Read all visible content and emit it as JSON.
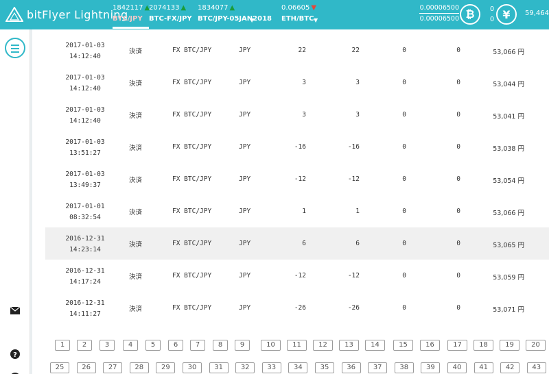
{
  "header": {
    "logo_text": "bitFlyer Lightning",
    "tabs": [
      {
        "price": "1842117",
        "trend": "up",
        "label": "BTC/JPY",
        "active": true
      },
      {
        "price": "2074133",
        "trend": "up",
        "label": "BTC-FX/JPY",
        "active": false
      },
      {
        "price": "1834077",
        "trend": "up",
        "label": "BTC/JPY-05JAN2018",
        "active": false
      },
      {
        "price": "0.06605",
        "trend": "down",
        "label": "ETH/BTC",
        "active": false
      }
    ],
    "btc_balance": {
      "value1": "0.00006500",
      "value2": "0.00006500",
      "icon": "bitcoin-icon"
    },
    "jpy_balance": {
      "value1": "0",
      "value2": "0",
      "icon": "yen-icon",
      "total": "59,464"
    }
  },
  "sidebar": {
    "icons": [
      "menu-icon",
      "mail-icon",
      "help-icon"
    ]
  },
  "table": {
    "rows": [
      {
        "date": "2017-01-03",
        "time": "14:12:40",
        "type": "決済",
        "product": "FX BTC/JPY",
        "currency": "JPY",
        "a": "22",
        "b": "22",
        "c": "0",
        "d": "0",
        "e": "53,066 円"
      },
      {
        "date": "2017-01-03",
        "time": "14:12:40",
        "type": "決済",
        "product": "FX BTC/JPY",
        "currency": "JPY",
        "a": "3",
        "b": "3",
        "c": "0",
        "d": "0",
        "e": "53,044 円"
      },
      {
        "date": "2017-01-03",
        "time": "14:12:40",
        "type": "決済",
        "product": "FX BTC/JPY",
        "currency": "JPY",
        "a": "3",
        "b": "3",
        "c": "0",
        "d": "0",
        "e": "53,041 円"
      },
      {
        "date": "2017-01-03",
        "time": "13:51:27",
        "type": "決済",
        "product": "FX BTC/JPY",
        "currency": "JPY",
        "a": "-16",
        "b": "-16",
        "c": "0",
        "d": "0",
        "e": "53,038 円"
      },
      {
        "date": "2017-01-03",
        "time": "13:49:37",
        "type": "決済",
        "product": "FX BTC/JPY",
        "currency": "JPY",
        "a": "-12",
        "b": "-12",
        "c": "0",
        "d": "0",
        "e": "53,054 円"
      },
      {
        "date": "2017-01-01",
        "time": "08:32:54",
        "type": "決済",
        "product": "FX BTC/JPY",
        "currency": "JPY",
        "a": "1",
        "b": "1",
        "c": "0",
        "d": "0",
        "e": "53,066 円"
      },
      {
        "date": "2016-12-31",
        "time": "14:23:14",
        "type": "決済",
        "product": "FX BTC/JPY",
        "currency": "JPY",
        "a": "6",
        "b": "6",
        "c": "0",
        "d": "0",
        "e": "53,065 円",
        "highlight": true
      },
      {
        "date": "2016-12-31",
        "time": "14:17:24",
        "type": "決済",
        "product": "FX BTC/JPY",
        "currency": "JPY",
        "a": "-12",
        "b": "-12",
        "c": "0",
        "d": "0",
        "e": "53,059 円"
      },
      {
        "date": "2016-12-31",
        "time": "14:11:27",
        "type": "決済",
        "product": "FX BTC/JPY",
        "currency": "JPY",
        "a": "-26",
        "b": "-26",
        "c": "0",
        "d": "0",
        "e": "53,071 円"
      }
    ]
  },
  "pagination": {
    "pages": [
      "1",
      "2",
      "3",
      "4",
      "5",
      "6",
      "7",
      "8",
      "9",
      "10",
      "11",
      "12",
      "13",
      "14",
      "15",
      "16",
      "17",
      "18",
      "19",
      "20",
      "25",
      "26",
      "27",
      "28",
      "29",
      "30",
      "31",
      "32",
      "33",
      "34",
      "35",
      "36",
      "37",
      "38",
      "39",
      "40",
      "41",
      "42",
      "43"
    ]
  }
}
